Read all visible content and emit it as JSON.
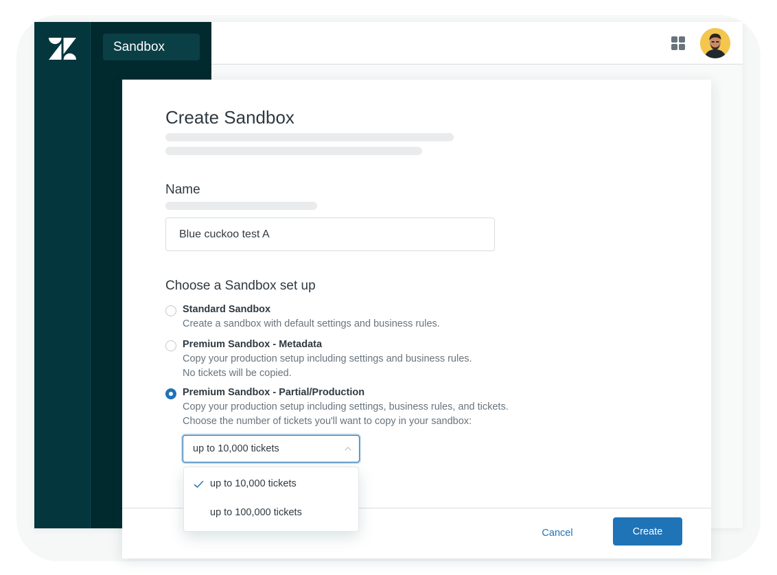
{
  "sidebar": {
    "active_item": "Sandbox"
  },
  "header": {
    "apps_icon": "apps-grid-icon",
    "avatar": "user-avatar"
  },
  "modal": {
    "title": "Create Sandbox",
    "name_section": {
      "label": "Name",
      "value": "Blue cuckoo test A"
    },
    "setup_section": {
      "label": "Choose a Sandbox set up",
      "options": [
        {
          "title": "Standard Sandbox",
          "description": [
            "Create a sandbox with default settings and business rules."
          ],
          "selected": false
        },
        {
          "title": "Premium Sandbox - Metadata",
          "description": [
            "Copy your production setup including settings and business rules.",
            "No tickets will be copied."
          ],
          "selected": false
        },
        {
          "title": "Premium Sandbox - Partial/Production",
          "description": [
            "Copy your production setup including settings, business rules, and tickets.",
            "Choose the number of tickets you'll want to copy in your sandbox:"
          ],
          "selected": true
        }
      ]
    },
    "ticket_select": {
      "value": "up to 10,000 tickets",
      "expanded": true,
      "options": [
        {
          "label": "up to 10,000 tickets",
          "checked": true
        },
        {
          "label": "up to 100,000 tickets",
          "checked": false
        }
      ]
    },
    "footer": {
      "cancel_label": "Cancel",
      "create_label": "Create"
    }
  },
  "colors": {
    "rail": "#03363d",
    "subnav": "#012a2f",
    "primary": "#1f73b7",
    "text": "#2f3941",
    "muted": "#68737d"
  }
}
